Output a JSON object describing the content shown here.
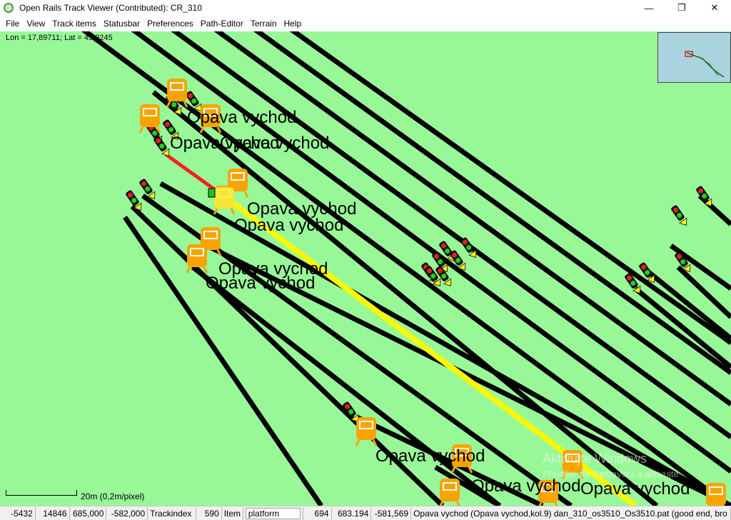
{
  "window": {
    "title": "Open Rails Track Viewer (Contributed): CR_310",
    "minimize": "—",
    "maximize": "❐",
    "close": "✕"
  },
  "menu": [
    "File",
    "View",
    "Track items",
    "Statusbar",
    "Preferences",
    "Path-Editor",
    "Terrain",
    "Help"
  ],
  "map": {
    "lonlat": "Lon = 17,89711; Lat = 49,9245",
    "station_label": "Opava vychod",
    "scale_label": "20m (0,2m/pixel)",
    "watermark_title": "Aktivujte Windows",
    "watermark_sub": "Přejděte do Nastavení a aktivujte",
    "colors": {
      "ground": "#98f898",
      "track": "#000000",
      "path": "#f8f800",
      "path_broken": "#f82020",
      "platform": "#f8a400"
    }
  },
  "status": {
    "tile_x": "-5432",
    "tile_z": "14846",
    "coord_x": "685,000",
    "coord_z": "-582,000",
    "trackindex_label": "Trackindex",
    "trackindex_value": "590",
    "item_label": "Item",
    "item_value": "platform",
    "item_index": "694",
    "item_x": "683.194",
    "item_z": "-581,569",
    "path_info": "Opava vychod (Opava vychod,kol.9) dan_310_os3510_Os3510.pat (good end, bro"
  }
}
